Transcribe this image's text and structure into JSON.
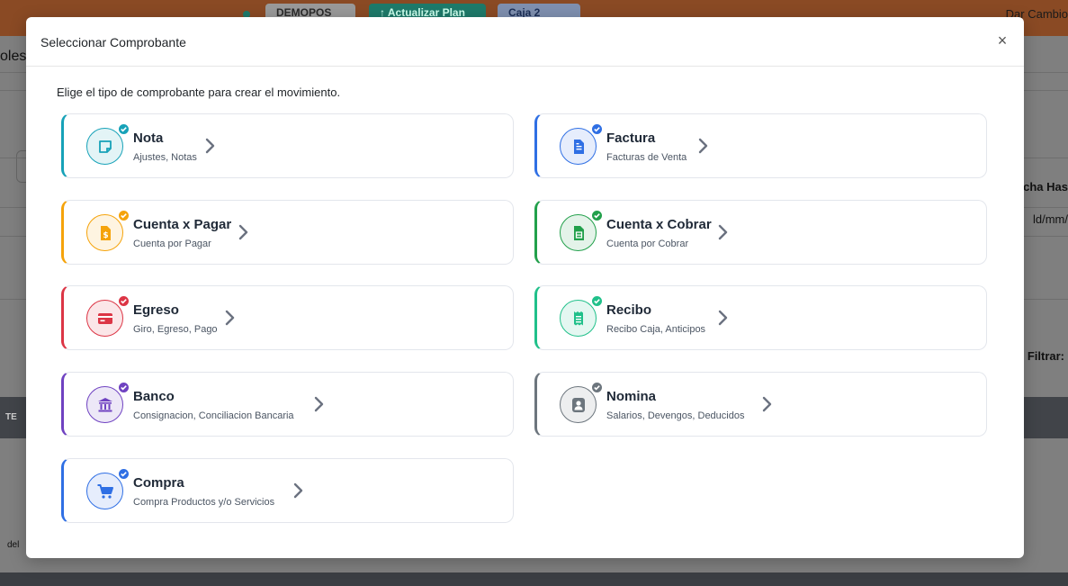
{
  "background": {
    "top_bar": {
      "company": "DEMOPOS",
      "upgrade_label": "↑ Actualizar Plan",
      "cash_label": "Caja 2",
      "change_label": "Dar Cambio"
    },
    "partial_texts": {
      "left_title": "oles",
      "date_to_label": "cha Has",
      "date_placeholder": "ld/mm/",
      "filter_label": "Filtrar:",
      "table_header_fragment": "TE",
      "footer_fragment": "del"
    }
  },
  "modal": {
    "title": "Seleccionar Comprobante",
    "close_symbol": "×",
    "intro": "Elige el tipo de comprobante para crear el movimiento."
  },
  "vouchers": [
    {
      "name": "Nota",
      "description": "Ajustes, Notas",
      "color": "#17a2b8",
      "icon": "note-icon"
    },
    {
      "name": "Factura",
      "description": "Facturas de Venta",
      "color": "#2f6fe4",
      "icon": "invoice-icon"
    },
    {
      "name": "Cuenta x Pagar",
      "description": "Cuenta por Pagar",
      "color": "#f5a30a",
      "icon": "payable-icon"
    },
    {
      "name": "Cuenta x Cobrar",
      "description": "Cuenta por Cobrar",
      "color": "#22a04b",
      "icon": "receivable-icon"
    },
    {
      "name": "Egreso",
      "description": "Giro, Egreso, Pago",
      "color": "#dc3545",
      "icon": "credit-card-icon"
    },
    {
      "name": "Recibo",
      "description": "Recibo Caja, Anticipos",
      "color": "#20c08a",
      "icon": "receipt-icon"
    },
    {
      "name": "Banco",
      "description": "Consignacion, Conciliacion Bancaria",
      "color": "#6f42c1",
      "icon": "bank-icon"
    },
    {
      "name": "Nomina",
      "description": "Salarios, Devengos, Deducidos",
      "color": "#6c757d",
      "icon": "person-badge-icon"
    },
    {
      "name": "Compra",
      "description": "Compra Productos y/o Servicios",
      "color": "#2f6fe4",
      "icon": "cart-icon"
    }
  ]
}
